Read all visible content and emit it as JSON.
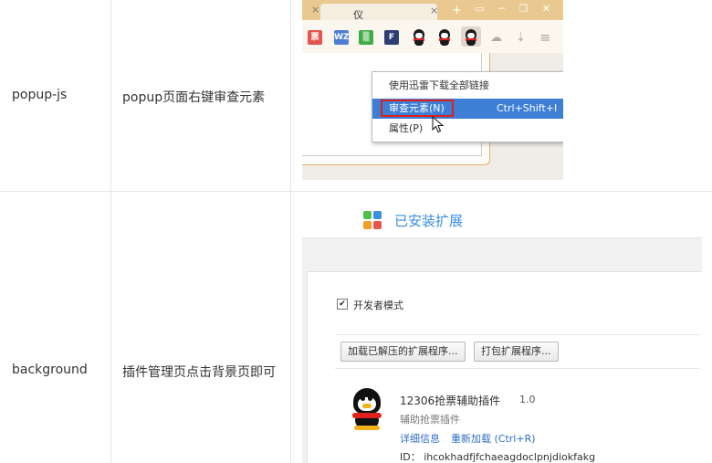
{
  "table": {
    "rows": [
      {
        "name": "popup-js",
        "method": "popup页面右键审查元素"
      },
      {
        "name": "background",
        "method": "插件管理页点击背景页即可"
      }
    ]
  },
  "browser": {
    "tab_title": "仪",
    "tab_close": "×",
    "new_tab": "+",
    "window_controls": "▭ ─ ❐ ✕",
    "extension_icons": [
      {
        "label": "票",
        "color": "#e5554f"
      },
      {
        "label": "WZ",
        "color": "#4f7fd4"
      },
      {
        "label": "▒",
        "color": "#3fae49"
      },
      {
        "label": "F",
        "color": "#2c3e73"
      }
    ],
    "extra_icons": [
      "cloud-icon",
      "download-icon",
      "menu-icon"
    ],
    "context_menu": {
      "items": [
        {
          "label": "使用迅雷下载全部链接",
          "shortcut": ""
        },
        {
          "label": "审查元素(N)",
          "shortcut": "Ctrl+Shift+I"
        },
        {
          "label": "属性(P)",
          "shortcut": ""
        }
      ],
      "highlight_color": "#3c7fd5",
      "annotation_color": "#e0201d"
    }
  },
  "extensions_page": {
    "title": "已安装扩展",
    "developer_mode_label": "开发者模式",
    "developer_mode_checked": "✔",
    "buttons": [
      "加载已解压的扩展程序...",
      "打包扩展程序..."
    ],
    "plugin": {
      "name": "12306抢票辅助插件",
      "version": "1.0",
      "description": "辅助抢票插件",
      "links": [
        "详细信息",
        "重新加载 (Ctrl+R)"
      ],
      "id_text": "ID： ihcokhadfjfchaeagdoclpnjdiokfakg"
    },
    "logo_colors": [
      "#4fc14b",
      "#3b8ee0",
      "#f39c27",
      "#e8554e"
    ]
  }
}
